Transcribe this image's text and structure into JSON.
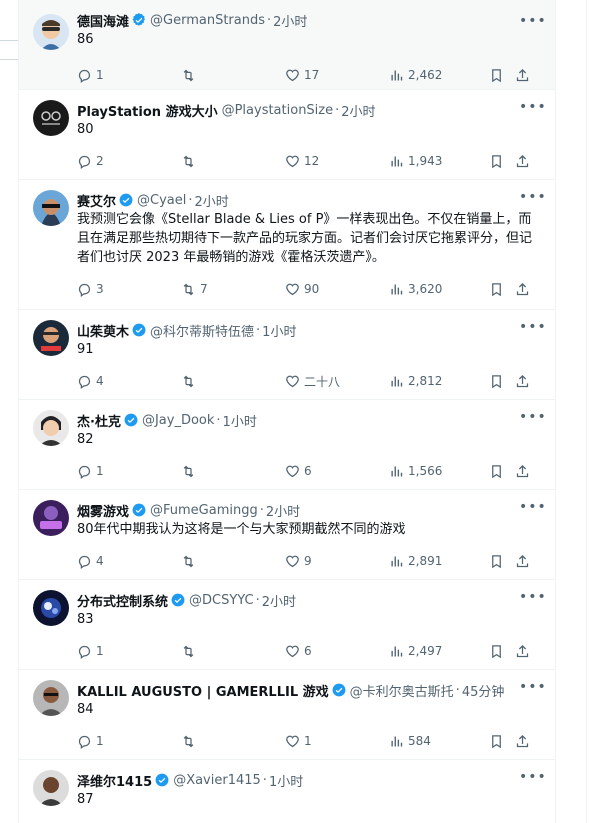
{
  "tweets": [
    {
      "name": "德国海滩",
      "verified": true,
      "handle": "@GermanStrands",
      "time": "2小时",
      "text": "86",
      "replies": "1",
      "retweets": "",
      "likes": "17",
      "views": "2,462"
    },
    {
      "name": "PlayStation 游戏大小",
      "verified": false,
      "handle": "@PlaystationSize",
      "time": "2小时",
      "text": "80",
      "replies": "2",
      "retweets": "",
      "likes": "12",
      "views": "1,943"
    },
    {
      "name": "赛艾尔",
      "verified": true,
      "handle": "@Cyael",
      "time": "2小时",
      "text": "我预测它会像《Stellar Blade & Lies of P》一样表现出色。不仅在销量上，而且在满足那些热切期待下一款产品的玩家方面。记者们会讨厌它拖累评分，但记者们也讨厌 2023 年最畅销的游戏《霍格沃茨遗产》。",
      "replies": "3",
      "retweets": "7",
      "likes": "90",
      "views": "3,620"
    },
    {
      "name": "山茱萸木",
      "verified": true,
      "handle": "@科尔蒂斯特伍德",
      "time": "1小时",
      "text": "91",
      "replies": "4",
      "retweets": "",
      "likes": "二十八",
      "views": "2,812"
    },
    {
      "name": "杰·杜克",
      "verified": true,
      "handle": "@Jay_Dook",
      "time": "1小时",
      "text": "82",
      "replies": "1",
      "retweets": "",
      "likes": "6",
      "views": "1,566"
    },
    {
      "name": "烟雾游戏",
      "verified": true,
      "handle": "@FumeGamingg",
      "time": "2小时",
      "text": "80年代中期我认为这将是一个与大家预期截然不同的游戏",
      "replies": "4",
      "retweets": "",
      "likes": "9",
      "views": "2,891"
    },
    {
      "name": "分布式控制系统",
      "verified": true,
      "handle": "@DCSYYC",
      "time": "2小时",
      "text": "83",
      "replies": "1",
      "retweets": "",
      "likes": "6",
      "views": "2,497"
    },
    {
      "name": "KALLIL AUGUSTO | GAMERLLIL 游戏",
      "verified": true,
      "handle": "@卡利尔奥古斯托",
      "time": "45分钟",
      "text": "84",
      "replies": "1",
      "retweets": "",
      "likes": "1",
      "views": "584"
    },
    {
      "name": "泽维尔1415",
      "verified": true,
      "handle": "@Xavier1415",
      "time": "1小时",
      "text": "87",
      "replies": "",
      "retweets": "",
      "likes": "",
      "views": ""
    }
  ],
  "more_icon": "more-horizontal-icon",
  "colors": {
    "verified": "#1d9bf0",
    "muted": "#536471",
    "text": "#0f1419",
    "hover_bg": "#f7f9f9"
  }
}
